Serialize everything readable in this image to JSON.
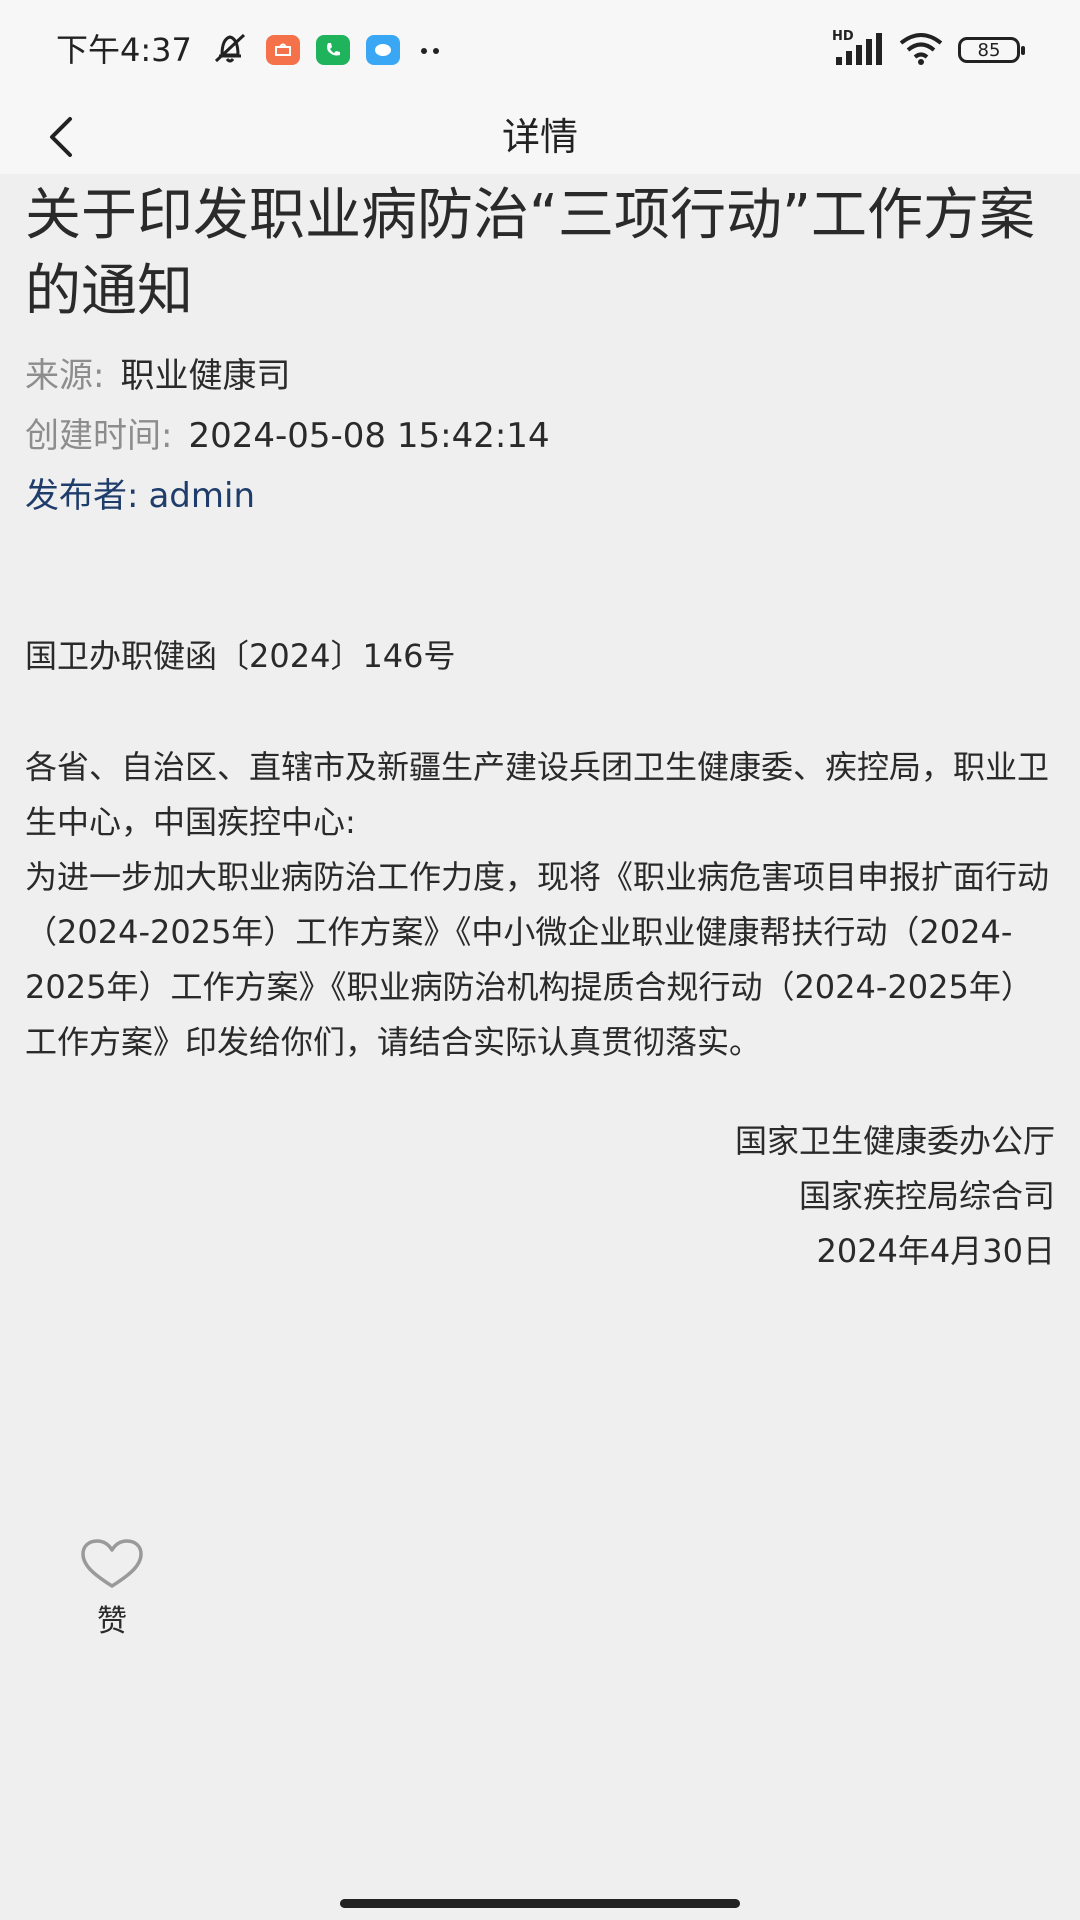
{
  "status_bar": {
    "time": "下午4:37",
    "battery": "85",
    "network_label": "HD",
    "icons": [
      "mute-icon",
      "app-orange-icon",
      "phone-icon",
      "chat-icon",
      "more-dots-icon",
      "signal-icon",
      "wifi-icon",
      "battery-icon"
    ],
    "colors": {
      "orange": "#f4714a",
      "green": "#1fb35c",
      "blue": "#3aa7f5"
    }
  },
  "nav": {
    "title": "详情",
    "back_icon": "chevron-left-icon"
  },
  "article": {
    "title": "关于印发职业病防治“三项行动”工作方案的通知",
    "meta": {
      "source_label": "来源:",
      "source_value": "职业健康司",
      "created_label": "创建时间:",
      "created_value": "2024-05-08 15:42:14",
      "publisher_label": "发布者:",
      "publisher_value": "admin"
    },
    "doc_number": "国卫办职健函〔2024〕146号",
    "paragraphs": [
      "各省、自治区、直辖市及新疆生产建设兵团卫生健康委、疾控局，职业卫生中心，中国疾控中心:",
      "为进一步加大职业病防治工作力度，现将《职业病危害项目申报扩面行动（2024-2025年）工作方案》《中小微企业职业健康帮扶行动（2024-2025年）工作方案》《职业病防治机构提质合规行动（2024-2025年）工作方案》印发给你们，请结合实际认真贯彻落实。"
    ],
    "signature": {
      "org1": "国家卫生健康委办公厅",
      "org2": "国家疾控局综合司",
      "date": "2024年4月30日"
    }
  },
  "like": {
    "label": "赞",
    "icon": "heart-outline-icon"
  }
}
